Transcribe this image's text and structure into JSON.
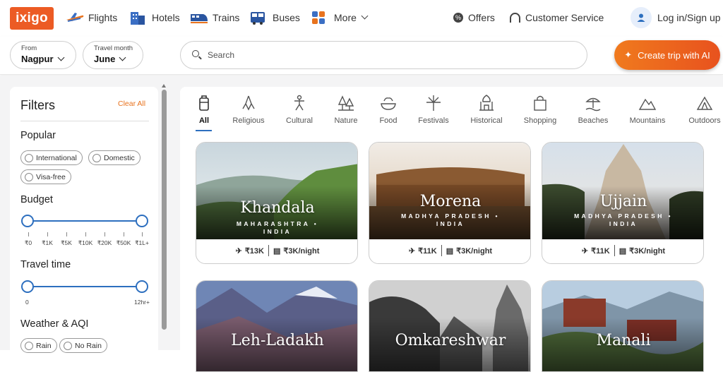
{
  "header": {
    "logo": "ixigo",
    "nav": [
      {
        "label": "Flights",
        "icon": "plane-icon"
      },
      {
        "label": "Hotels",
        "icon": "hotel-icon"
      },
      {
        "label": "Trains",
        "icon": "train-icon"
      },
      {
        "label": "Buses",
        "icon": "bus-icon"
      },
      {
        "label": "More",
        "icon": "grid-icon"
      }
    ],
    "offers": "Offers",
    "customer_service": "Customer Service",
    "login": "Log in/Sign up"
  },
  "toolbar": {
    "from_label": "From",
    "from_value": "Nagpur",
    "month_label": "Travel month",
    "month_value": "June",
    "search_placeholder": "Search",
    "ai_button": "Create trip with AI"
  },
  "filters": {
    "title": "Filters",
    "clear_all": "Clear All",
    "popular_title": "Popular",
    "popular_chips": [
      "International",
      "Domestic",
      "Visa-free"
    ],
    "budget_title": "Budget",
    "budget_ticks": [
      "₹0",
      "₹1K",
      "₹5K",
      "₹10K",
      "₹20K",
      "₹50K",
      "₹1L+"
    ],
    "budget_range": [
      "₹0",
      "₹1L+"
    ],
    "travel_time_title": "Travel time",
    "travel_time_min": "0",
    "travel_time_max": "12hr+",
    "weather_title": "Weather & AQI",
    "weather_chips": [
      "Rain",
      "No Rain"
    ]
  },
  "categories": [
    {
      "label": "All",
      "icon": "luggage-icon",
      "active": true
    },
    {
      "label": "Religious",
      "icon": "praying-hands-icon"
    },
    {
      "label": "Cultural",
      "icon": "dancer-icon"
    },
    {
      "label": "Nature",
      "icon": "trees-icon"
    },
    {
      "label": "Food",
      "icon": "food-icon"
    },
    {
      "label": "Festivals",
      "icon": "fireworks-icon"
    },
    {
      "label": "Historical",
      "icon": "monument-icon"
    },
    {
      "label": "Shopping",
      "icon": "shopping-bag-icon"
    },
    {
      "label": "Beaches",
      "icon": "beach-icon"
    },
    {
      "label": "Mountains",
      "icon": "mountain-icon"
    },
    {
      "label": "Outdoors",
      "icon": "tent-icon"
    }
  ],
  "destinations": [
    {
      "name": "Khandala",
      "state": "MAHARASHTRA • INDIA",
      "flight": "₹13K",
      "hotel": "₹3K/night"
    },
    {
      "name": "Morena",
      "state": "MADHYA PRADESH • INDIA",
      "flight": "₹11K",
      "hotel": "₹3K/night"
    },
    {
      "name": "Ujjain",
      "state": "MADHYA PRADESH • INDIA",
      "flight": "₹11K",
      "hotel": "₹3K/night"
    },
    {
      "name": "Leh-Ladakh"
    },
    {
      "name": "Omkareshwar"
    },
    {
      "name": "Manali"
    }
  ],
  "colors": {
    "brand": "#ec5b24",
    "accent": "#2d6fbf",
    "clear_all": "#e8731e"
  }
}
